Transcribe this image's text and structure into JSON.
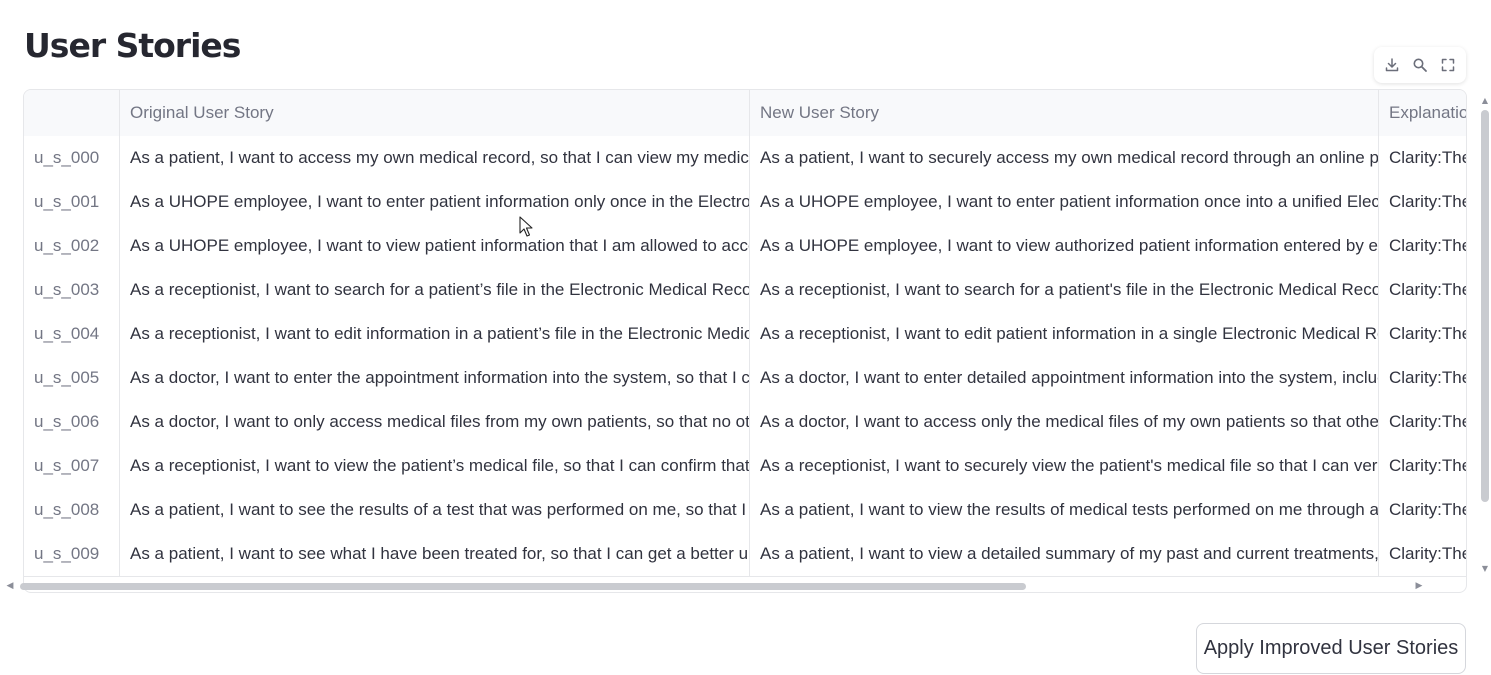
{
  "page": {
    "title": "User Stories"
  },
  "toolbar": {
    "icons": [
      "download-icon",
      "search-icon",
      "fullscreen-icon"
    ]
  },
  "table": {
    "columns": [
      "",
      "Original User Story",
      "New User Story",
      "Explanation"
    ],
    "rows": [
      {
        "id": "u_s_000",
        "original": "As a patient, I want to access my own medical record, so that I can view my medical h",
        "new": "As a patient, I want to securely access my own medical record through an online port",
        "explanation": "Clarity:The"
      },
      {
        "id": "u_s_001",
        "original": "As a UHOPE employee, I want to enter patient information only once in the Electronic",
        "new": "As a UHOPE employee, I want to enter patient information once into a unified Electro",
        "explanation": "Clarity:The"
      },
      {
        "id": "u_s_002",
        "original": "As a UHOPE employee, I want to view patient information that I am allowed to access",
        "new": "As a UHOPE employee, I want to view authorized patient information entered by emp",
        "explanation": "Clarity:The"
      },
      {
        "id": "u_s_003",
        "original": "As a receptionist, I want to search for a patient’s file in the Electronic Medical Record I",
        "new": "As a receptionist, I want to search for a patient's file in the Electronic Medical Record I",
        "explanation": "Clarity:The"
      },
      {
        "id": "u_s_004",
        "original": "As a receptionist, I want to edit information in a patient’s file in the Electronic Medica",
        "new": "As a receptionist, I want to edit patient information in a single Electronic Medical Reco",
        "explanation": "Clarity:The"
      },
      {
        "id": "u_s_005",
        "original": "As a doctor, I want to enter the appointment information into the system, so that I ca",
        "new": "As a doctor, I want to enter detailed appointment information into the system, includ",
        "explanation": "Clarity:The"
      },
      {
        "id": "u_s_006",
        "original": "As a doctor, I want to only access medical files from my own patients, so that no othe",
        "new": "As a doctor, I want to access only the medical files of my own patients so that other do",
        "explanation": "Clarity:The"
      },
      {
        "id": "u_s_007",
        "original": "As a receptionist, I want to view the patient’s medical file, so that I can confirm that so",
        "new": "As a receptionist, I want to securely view the patient's medical file so that I can verify",
        "explanation": "Clarity:The"
      },
      {
        "id": "u_s_008",
        "original": "As a patient, I want to see the results of a test that was performed on me, so that I car",
        "new": "As a patient, I want to view the results of medical tests performed on me through a se",
        "explanation": "Clarity:The"
      },
      {
        "id": "u_s_009",
        "original": "As a patient, I want to see what I have been treated for, so that I can get a better unde",
        "new": "As a patient, I want to view a detailed summary of my past and current treatments, in",
        "explanation": "Clarity:The"
      }
    ]
  },
  "actions": {
    "apply_label": "Apply Improved User Stories"
  }
}
